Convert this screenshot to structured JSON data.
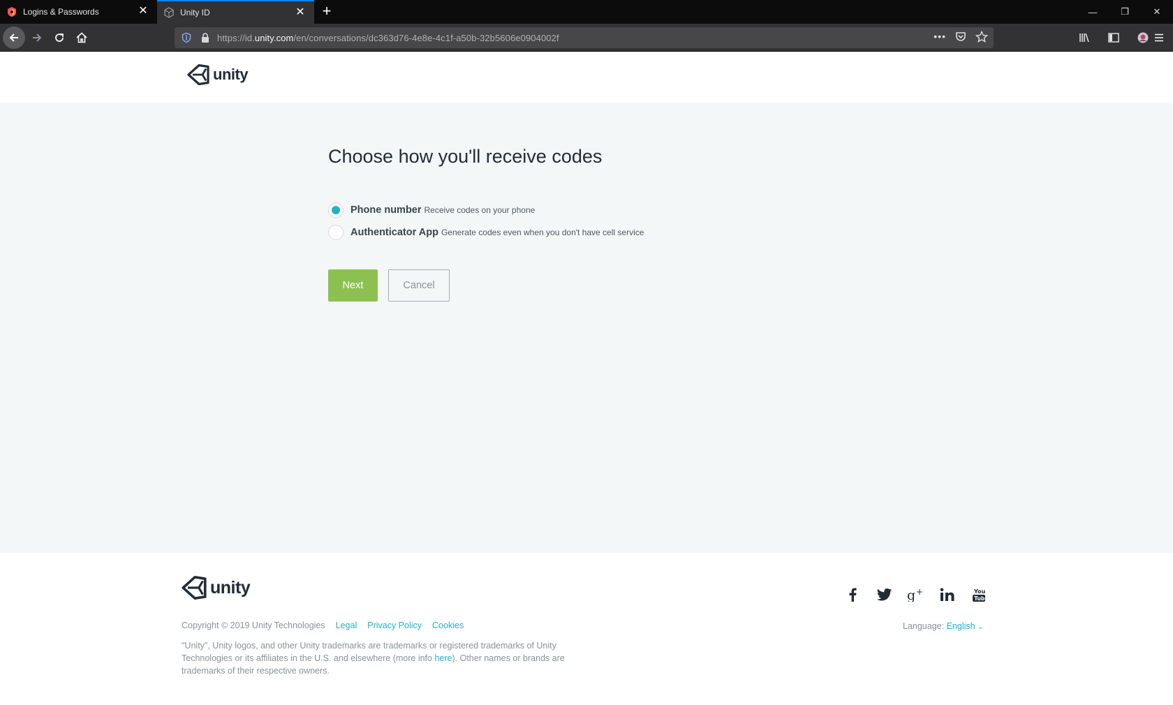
{
  "browser": {
    "tabs": [
      {
        "label": "Logins & Passwords",
        "favicon": "lockwise-icon"
      },
      {
        "label": "Unity ID",
        "favicon": "unity-icon"
      }
    ],
    "url": {
      "prefix": "https://id.",
      "domain": "unity.com",
      "path": "/en/conversations/dc363d76-4e8e-4c1f-a50b-32b5606e0904002f"
    }
  },
  "header": {
    "logo_text": "unity"
  },
  "main": {
    "heading": "Choose how you'll receive codes",
    "options": [
      {
        "title": "Phone number",
        "description": "Receive codes on your phone",
        "checked": true
      },
      {
        "title": "Authenticator App",
        "description": "Generate codes even when you don't have cell service",
        "checked": false
      }
    ],
    "next_label": "Next",
    "cancel_label": "Cancel",
    "accent_color": "#1fb2c8",
    "primary_button_color": "#8cc152"
  },
  "footer": {
    "logo_text": "unity",
    "copyright": "Copyright © 2019 Unity Technologies",
    "links": {
      "legal": "Legal",
      "privacy": "Privacy Policy",
      "cookies": "Cookies"
    },
    "legal_text_before": "\"Unity\", Unity logos, and other Unity trademarks are trademarks or registered trademarks of Unity Technologies or its affiliates in the U.S. and elsewhere (more info ",
    "legal_link": "here",
    "legal_text_after": "). Other names or brands are trademarks of their respective owners.",
    "language_label": "Language:",
    "language_value": "English",
    "social": [
      "facebook-icon",
      "twitter-icon",
      "google-plus-icon",
      "linkedin-icon",
      "youtube-icon"
    ]
  }
}
